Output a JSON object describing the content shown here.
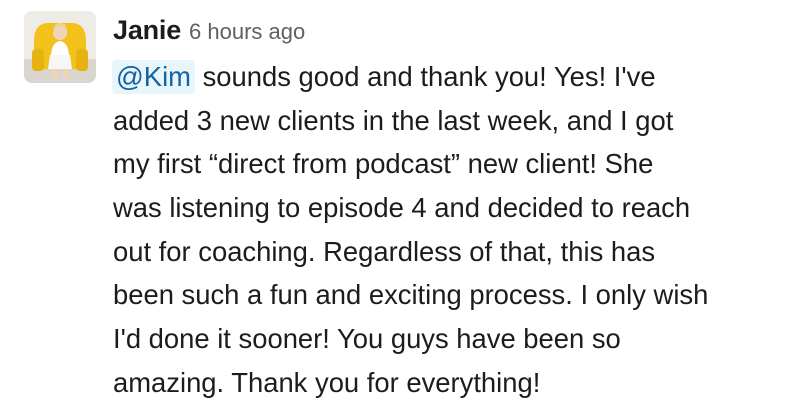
{
  "message": {
    "author": "Janie",
    "timestamp": "6 hours ago",
    "mention": "@Kim",
    "lines": [
      " sounds good and thank you! Yes! I've",
      "added 3 new clients in the last week, and I got",
      "my first “direct from podcast” new client! She",
      "was listening to episode 4 and decided to reach",
      "out for coaching. Regardless of that, this has",
      "been such a fun and exciting process. I only wish",
      "I'd done it sooner! You guys have been so",
      "amazing. Thank you for everything!"
    ]
  },
  "colors": {
    "text": "#1d1c1d",
    "timestamp": "#616061",
    "mention_text": "#1264a3",
    "mention_bg": "#e8f5fa",
    "avatar_chair": "#f2c21b"
  }
}
